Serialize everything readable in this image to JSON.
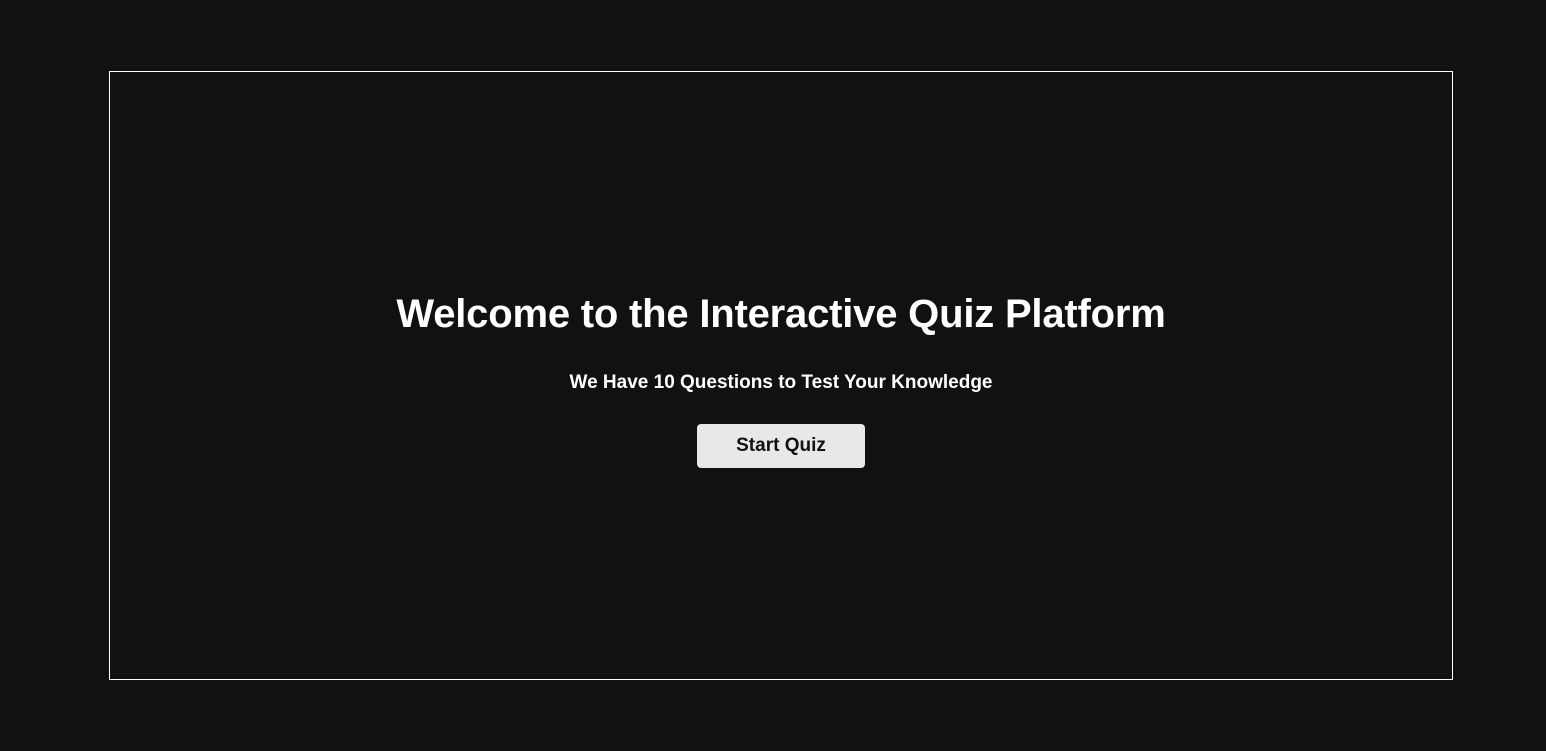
{
  "welcome": {
    "title": "Welcome to the Interactive Quiz Platform",
    "subtitle": "We Have 10 Questions to Test Your Knowledge",
    "start_button_label": "Start Quiz"
  },
  "colors": {
    "background": "#111111",
    "frame_border": "#ffffff",
    "text": "#ffffff",
    "button_background": "#e8e8e8",
    "button_text": "#111111"
  }
}
